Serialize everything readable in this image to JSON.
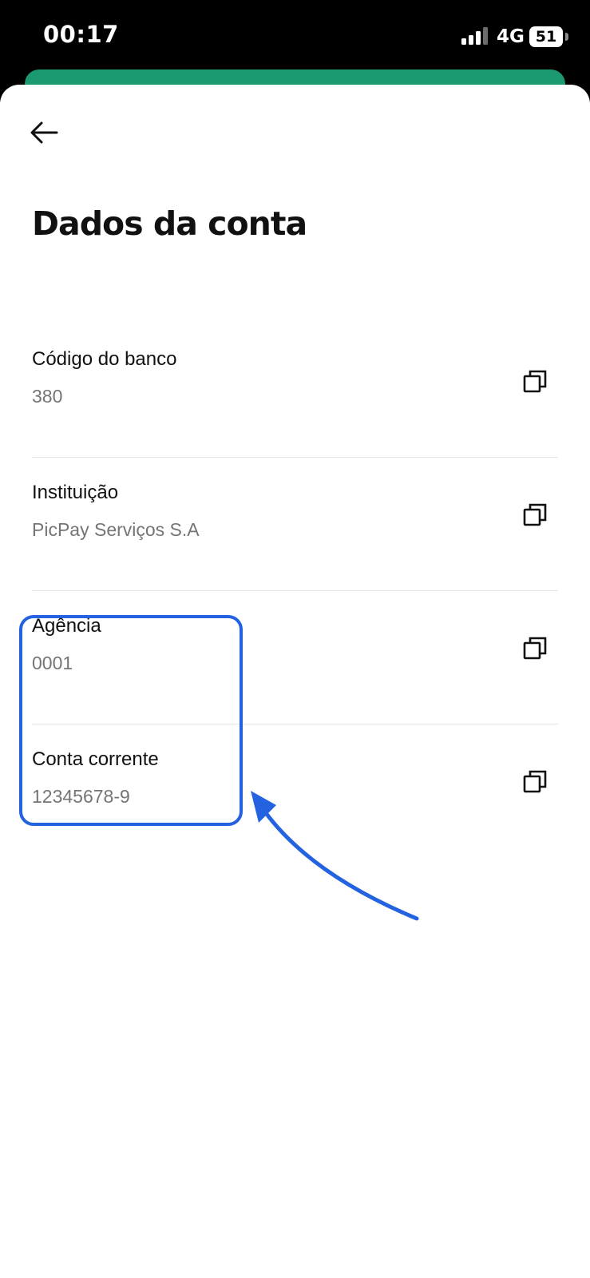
{
  "status_bar": {
    "time": "00:17",
    "network": "4G",
    "battery": "51"
  },
  "header": {
    "back_icon": "arrow-left-icon",
    "title": "Dados da conta"
  },
  "fields": [
    {
      "label": "Código do banco",
      "value": "380",
      "copy_icon": "copy-icon"
    },
    {
      "label": "Instituição",
      "value": "PicPay Serviços S.A",
      "copy_icon": "copy-icon"
    },
    {
      "label": "Agência",
      "value": "0001",
      "copy_icon": "copy-icon"
    },
    {
      "label": "Conta corrente",
      "value": "12345678-9",
      "copy_icon": "copy-icon"
    }
  ],
  "colors": {
    "accent_green": "#1b9a72",
    "annotation_blue": "#2463e0",
    "label_text": "#111111",
    "value_text": "#757575"
  }
}
